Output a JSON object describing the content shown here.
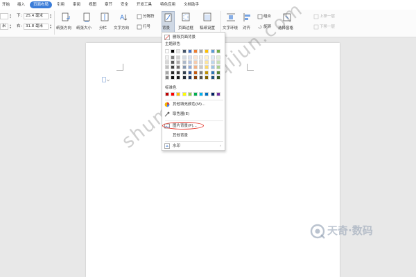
{
  "menu": {
    "items": [
      "开始",
      "插入",
      "页面布局",
      "引用",
      "审阅",
      "视图",
      "章节",
      "安全",
      "开发工具",
      "特色应用",
      "文档助手"
    ],
    "active": "页面布局",
    "active_color": "#3a7cd8"
  },
  "ribbon": {
    "margins": {
      "top_left": "",
      "top_label": "下:",
      "top_value": "25.4 毫米",
      "bottom_left": "米",
      "right_label": "右:",
      "right_value": "31.8 毫米"
    },
    "buttons": {
      "orientation": "纸张方向",
      "size": "纸张大小",
      "columns": "分栏",
      "text_direction": "文字方向",
      "breaks": "分隔符",
      "line_numbers": "行号",
      "background": "背景",
      "page_border": "页面边框",
      "manuscript": "稿纸设置",
      "wrap_text": "文字环绕",
      "align": "对齐",
      "group": "组合",
      "rotate": "旋转",
      "selection_pane": "选择窗格",
      "bring_forward": "上移一层",
      "send_backward": "下移一层"
    }
  },
  "dropdown": {
    "delete_bg": "删除页面背景",
    "theme_colors_title": "主题颜色",
    "standard_colors_title": "标准色",
    "more_fill": "其他填充颜色(M)...",
    "eyedropper": "取色器(E)",
    "picture_bg": "图片背景(P)...",
    "other_bg": "其他背景",
    "watermark": "水印",
    "theme_top_row": [
      "#ffffff",
      "#000000",
      "#e7e6e6",
      "#44546a",
      "#4472c4",
      "#ed7d31",
      "#a5a5a5",
      "#ffc000",
      "#5b9bd5",
      "#70ad47"
    ],
    "theme_shades": [
      [
        "#f2f2f2",
        "#7f7f7f",
        "#d0cece",
        "#d6dce4",
        "#d9e2f3",
        "#fbe5d5",
        "#ededed",
        "#fff2cc",
        "#deebf6",
        "#e2efd9"
      ],
      [
        "#d8d8d8",
        "#595959",
        "#aeabab",
        "#adb9ca",
        "#b4c6e7",
        "#f7cbac",
        "#dbdbdb",
        "#fee599",
        "#bdd7ee",
        "#c5e0b3"
      ],
      [
        "#bfbfbf",
        "#3f3f3f",
        "#757070",
        "#8496b0",
        "#8eaadb",
        "#f4b183",
        "#c9c9c9",
        "#ffd965",
        "#9cc3e5",
        "#a8d08d"
      ],
      [
        "#a5a5a5",
        "#262626",
        "#3a3838",
        "#323f4f",
        "#2f5496",
        "#c55a11",
        "#7b7b7b",
        "#bf8f00",
        "#2e75b5",
        "#538135"
      ],
      [
        "#7f7f7f",
        "#0c0c0c",
        "#171616",
        "#222a35",
        "#1f3864",
        "#833c0b",
        "#525252",
        "#7f6000",
        "#1e4e79",
        "#375623"
      ]
    ],
    "standard_colors": [
      "#c00000",
      "#ff0000",
      "#ffc000",
      "#ffff00",
      "#92d050",
      "#00b050",
      "#00b0f0",
      "#0070c0",
      "#002060",
      "#7030a0"
    ],
    "highlight_color": "#e53e33"
  },
  "watermark": {
    "diagonal": "shuma.tianqijun.com",
    "logo_text": "天奇·数码"
  }
}
